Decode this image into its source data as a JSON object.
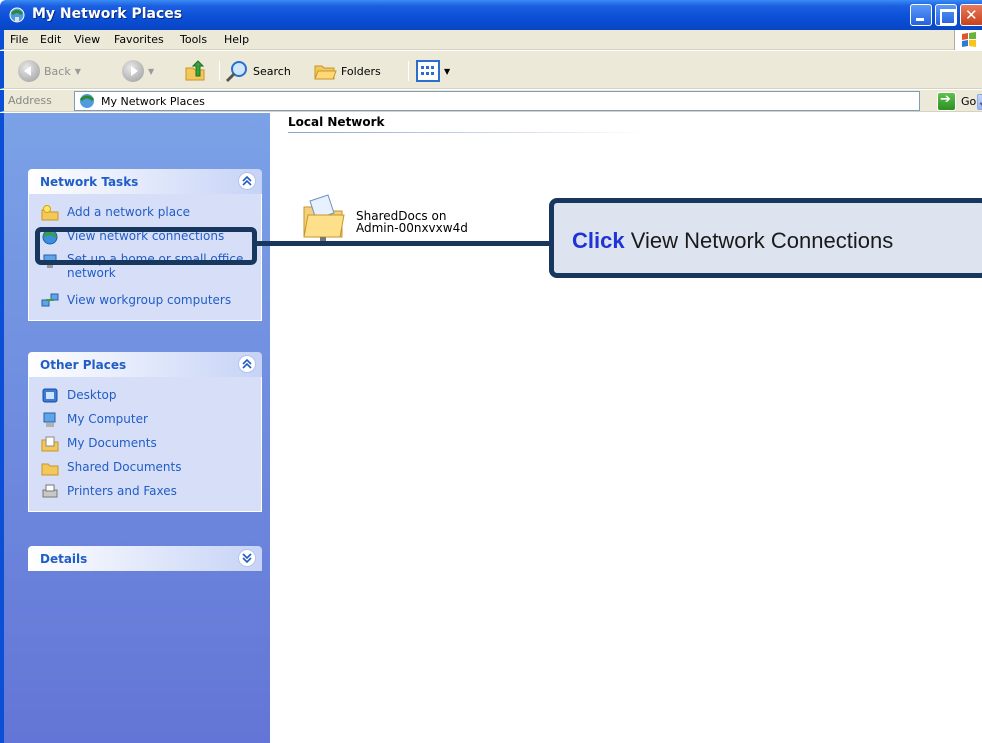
{
  "window": {
    "title": "My Network Places"
  },
  "menu": {
    "items": [
      "File",
      "Edit",
      "View",
      "Favorites",
      "Tools",
      "Help"
    ]
  },
  "toolbar": {
    "back_label": "Back",
    "search_label": "Search",
    "folders_label": "Folders"
  },
  "address": {
    "label": "Address",
    "value": "My Network Places",
    "go_label": "Go"
  },
  "network_tasks": {
    "title": "Network Tasks",
    "items": [
      "Add a network place",
      "View network connections",
      "Set up a home or small office network",
      "View workgroup computers"
    ]
  },
  "other_places": {
    "title": "Other Places",
    "items": [
      "Desktop",
      "My Computer",
      "My Documents",
      "Shared Documents",
      "Printers and Faxes"
    ]
  },
  "details": {
    "title": "Details"
  },
  "content": {
    "group_header": "Local Network",
    "items": [
      {
        "line1": "SharedDocs on",
        "line2": "Admin-00nxvxw4d"
      }
    ]
  },
  "callout": {
    "action": "Click",
    "text": "View Network Connections"
  },
  "colors": {
    "titlebar": "#0a4fd6",
    "task_link": "#215dc6",
    "callout_border": "#17375e",
    "callout_accent": "#1f33d6"
  }
}
